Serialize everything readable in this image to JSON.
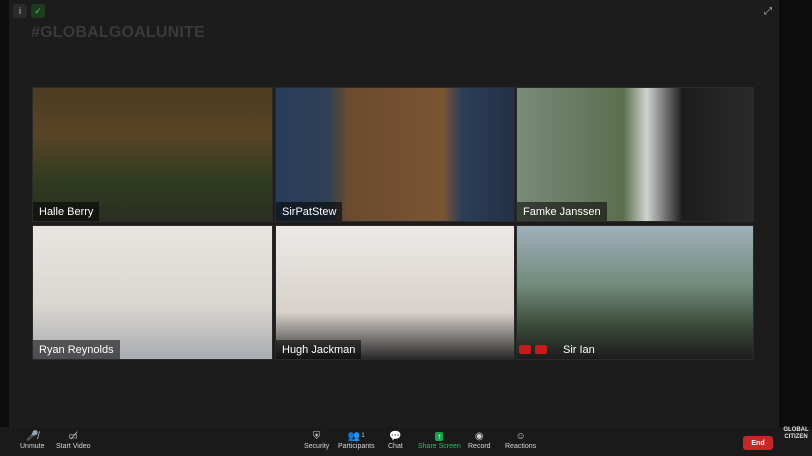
{
  "hashtag": "#GLOBALGOALUNITE",
  "icons": {
    "info": "info-icon",
    "security": "shield-icon",
    "fullscreen": "fullscreen-icon"
  },
  "participants": [
    {
      "name": "Halle Berry"
    },
    {
      "name": "SirPatStew"
    },
    {
      "name": "Famke Janssen"
    },
    {
      "name": "Ryan Reynolds"
    },
    {
      "name": "Hugh Jackman"
    },
    {
      "name": "Sir Ian"
    }
  ],
  "toolbar": {
    "unmute": "Unmute",
    "start_video": "Start Video",
    "security": "Security",
    "participants": "Participants",
    "participants_count": "1",
    "chat": "Chat",
    "share_screen": "Share Screen",
    "record": "Record",
    "reactions": "Reactions",
    "end": "End"
  },
  "brand": {
    "line1": "GLOBAL",
    "line2": "CITIZEN"
  }
}
